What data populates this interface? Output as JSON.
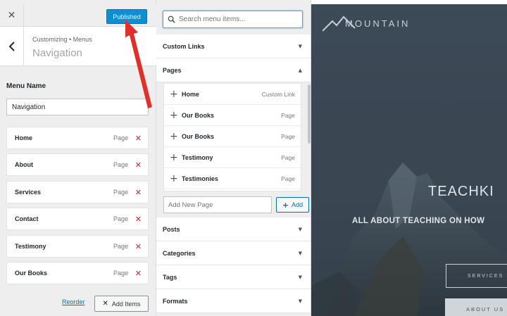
{
  "header": {
    "close_icon": "close-icon",
    "publish_label": "Published"
  },
  "section": {
    "breadcrumb": "Customizing • Menus",
    "title": "Navigation",
    "back_icon": "chevron-left-icon"
  },
  "menu_name": {
    "label": "Menu Name",
    "value": "Navigation"
  },
  "menu_items": [
    {
      "title": "Home",
      "type": "Page"
    },
    {
      "title": "About",
      "type": "Page"
    },
    {
      "title": "Services",
      "type": "Page"
    },
    {
      "title": "Contact",
      "type": "Page"
    },
    {
      "title": "Testimony",
      "type": "Page"
    },
    {
      "title": "Our Books",
      "type": "Page"
    }
  ],
  "footer": {
    "reorder_label": "Reorder",
    "add_items_label": "Add Items"
  },
  "available": {
    "search_placeholder": "Search menu items...",
    "sections": {
      "custom_links": "Custom Links",
      "pages": "Pages",
      "posts": "Posts",
      "categories": "Categories",
      "tags": "Tags",
      "formats": "Formats"
    },
    "pages_list": [
      {
        "title": "Home",
        "type": "Custom Link"
      },
      {
        "title": "Our Books",
        "type": "Page"
      },
      {
        "title": "Our Books",
        "type": "Page"
      },
      {
        "title": "Testimony",
        "type": "Page"
      },
      {
        "title": "Testimonies",
        "type": "Page"
      }
    ],
    "add_new_page_placeholder": "Add New Page",
    "add_label": "Add"
  },
  "preview": {
    "logo_text": "MOUNTAIN",
    "hero_title": "TEACHKI",
    "hero_subtitle": "ALL ABOUT TEACHING ON HOW",
    "services_label": "SERVICES",
    "about_label": "ABOUT US"
  },
  "colors": {
    "publish_button": "#0e8fd1",
    "remove_icon": "#c9232d",
    "annotation_arrow": "#e0302a",
    "link": "#0073aa"
  }
}
